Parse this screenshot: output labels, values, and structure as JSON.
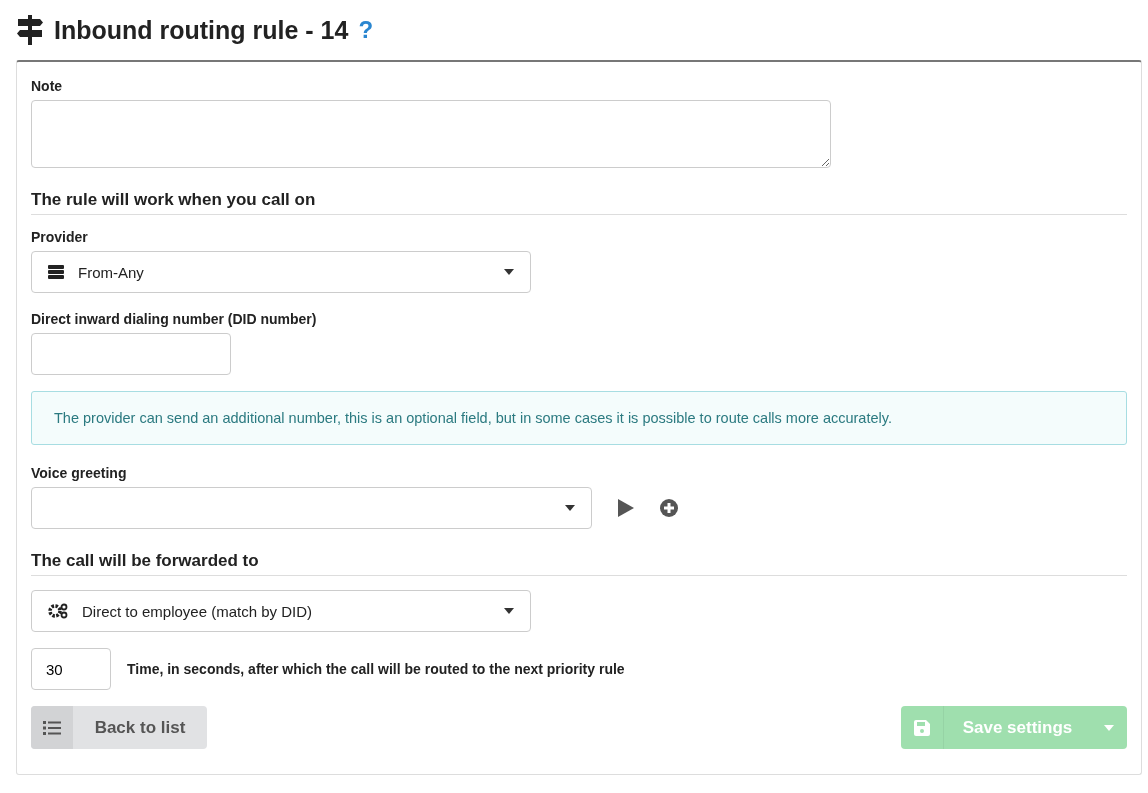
{
  "page_title": "Inbound routing rule - 14",
  "help": "?",
  "note": {
    "label": "Note"
  },
  "sections": [
    {
      "title": "The rule will work when you call on"
    },
    {
      "title": "The call will be forwarded to"
    }
  ],
  "provider": {
    "label": "Provider",
    "value": "From-Any"
  },
  "did": {
    "label": "Direct inward dialing number (DID number)"
  },
  "info": "The provider can send an additional number, this is an optional field, but in some cases it is possible to route calls more accurately.",
  "greeting": {
    "label": "Voice greeting"
  },
  "forward": {
    "value": "Direct to employee (match by DID)"
  },
  "timeout": {
    "value": "30",
    "label": "Time, in seconds, after which the call will be routed to the next priority rule"
  },
  "back_button": {
    "label": "Back to list"
  },
  "save_button": {
    "label": "Save settings",
    "disabled": true
  }
}
